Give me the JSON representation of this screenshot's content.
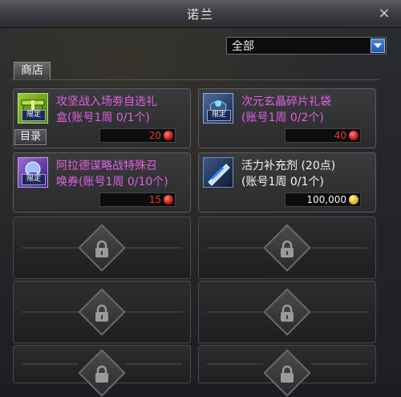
{
  "window": {
    "title": "诺兰",
    "close_glyph": "×"
  },
  "filter": {
    "selected": "全部"
  },
  "tabs": [
    {
      "label": "商店"
    }
  ],
  "catalog_button": {
    "label": "目录"
  },
  "items": [
    {
      "name_line1": "攻坚战入场劵自选礼",
      "name_line2": "盒(账号1周 0/1个)",
      "badge": "限定",
      "price": "20",
      "currency": "red-gem-icon",
      "name_color": "#e060e0"
    },
    {
      "name_line1": "次元玄晶碎片礼袋",
      "name_line2": "(账号1周 0/2个)",
      "badge": "限定",
      "price": "40",
      "currency": "red-gem-icon",
      "name_color": "#e060e0"
    },
    {
      "name_line1": "阿拉德谋略战特殊召",
      "name_line2": "唤券(账号1周 0/10个)",
      "badge": "限定",
      "price": "15",
      "currency": "red-gem-icon",
      "name_color": "#e060e0"
    },
    {
      "name_line1": "活力补充剂 (20点)",
      "name_line2": "(账号1周 0/1个)",
      "badge": "",
      "price": "100,000",
      "currency": "gold-coin-icon",
      "name_color": "#f2f2f2"
    }
  ],
  "locked_slots": 6
}
